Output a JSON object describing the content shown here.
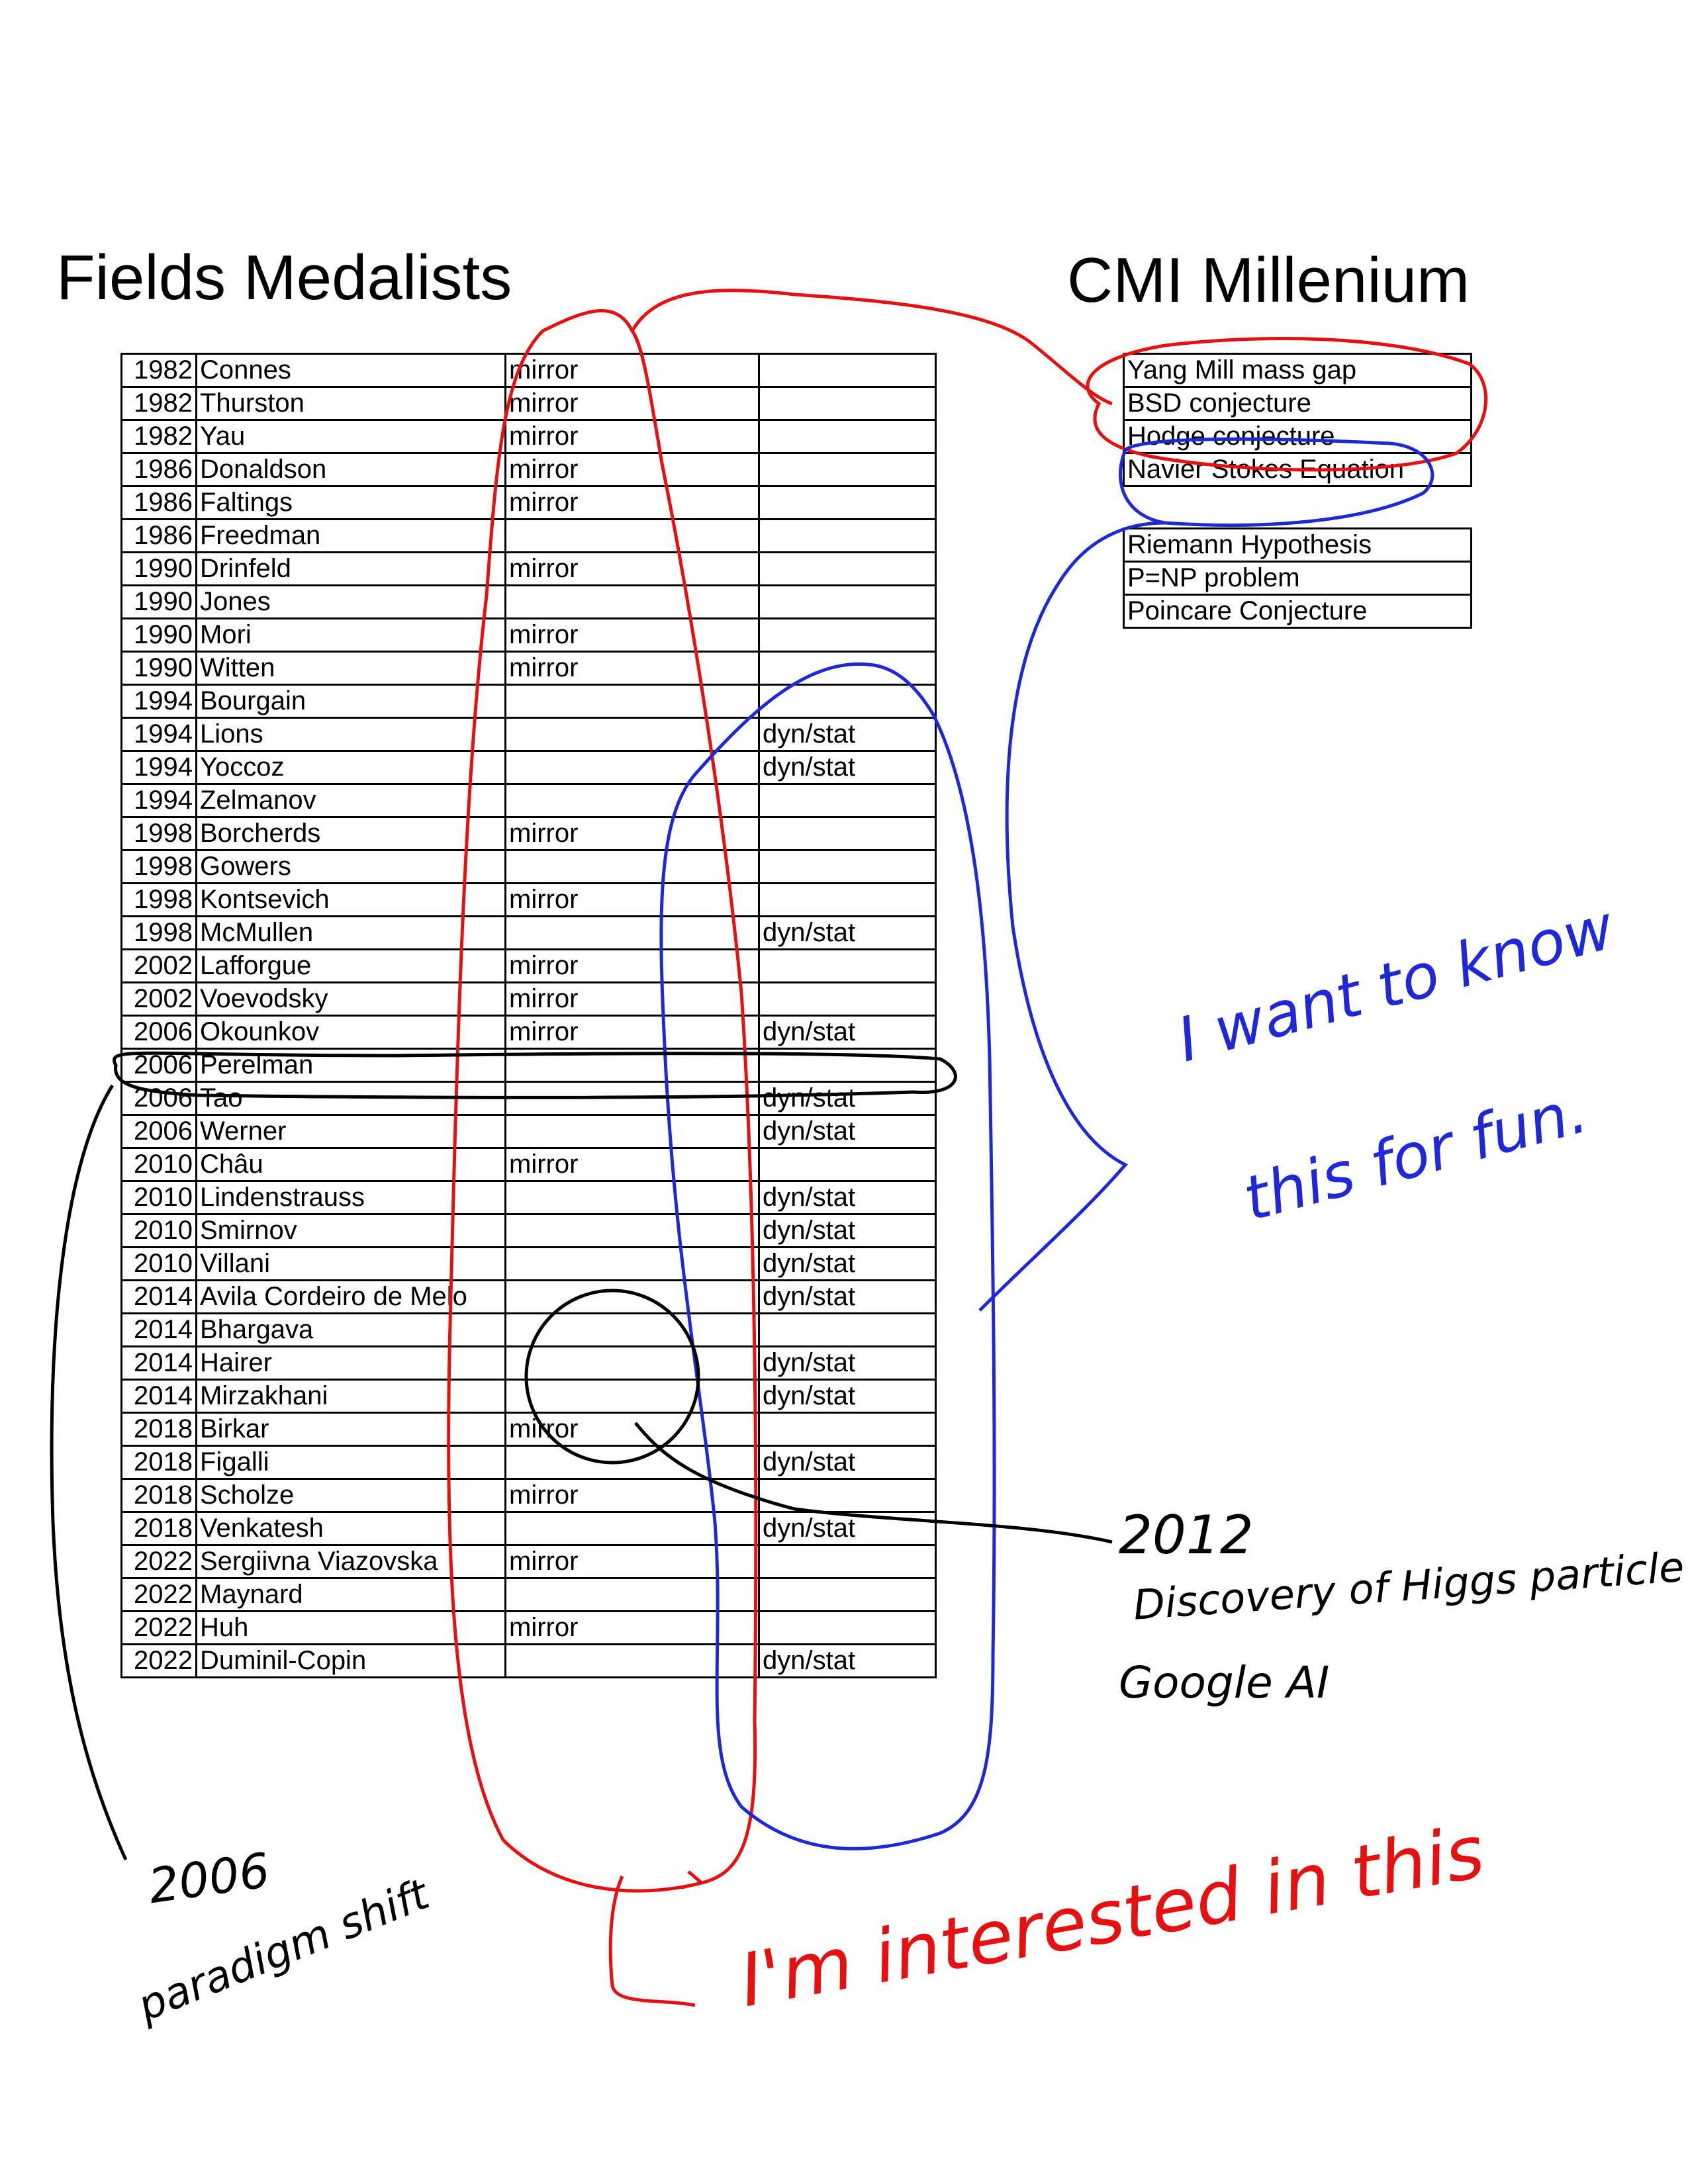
{
  "fields": {
    "title": "Fields Medalists",
    "rows": [
      {
        "year": "1982",
        "name": "Connes",
        "mirror": "mirror",
        "dyn": ""
      },
      {
        "year": "1982",
        "name": "Thurston",
        "mirror": "mirror",
        "dyn": ""
      },
      {
        "year": "1982",
        "name": "Yau",
        "mirror": "mirror",
        "dyn": ""
      },
      {
        "year": "1986",
        "name": "Donaldson",
        "mirror": "mirror",
        "dyn": ""
      },
      {
        "year": "1986",
        "name": "Faltings",
        "mirror": "mirror",
        "dyn": ""
      },
      {
        "year": "1986",
        "name": "Freedman",
        "mirror": "",
        "dyn": ""
      },
      {
        "year": "1990",
        "name": "Drinfeld",
        "mirror": "mirror",
        "dyn": ""
      },
      {
        "year": "1990",
        "name": "Jones",
        "mirror": "",
        "dyn": ""
      },
      {
        "year": "1990",
        "name": "Mori",
        "mirror": "mirror",
        "dyn": ""
      },
      {
        "year": "1990",
        "name": "Witten",
        "mirror": "mirror",
        "dyn": ""
      },
      {
        "year": "1994",
        "name": "Bourgain",
        "mirror": "",
        "dyn": ""
      },
      {
        "year": "1994",
        "name": "Lions",
        "mirror": "",
        "dyn": "dyn/stat"
      },
      {
        "year": "1994",
        "name": "Yoccoz",
        "mirror": "",
        "dyn": "dyn/stat"
      },
      {
        "year": "1994",
        "name": "Zelmanov",
        "mirror": "",
        "dyn": ""
      },
      {
        "year": "1998",
        "name": "Borcherds",
        "mirror": "mirror",
        "dyn": ""
      },
      {
        "year": "1998",
        "name": "Gowers",
        "mirror": "",
        "dyn": ""
      },
      {
        "year": "1998",
        "name": "Kontsevich",
        "mirror": "mirror",
        "dyn": ""
      },
      {
        "year": "1998",
        "name": "McMullen",
        "mirror": "",
        "dyn": "dyn/stat"
      },
      {
        "year": "2002",
        "name": "Lafforgue",
        "mirror": "mirror",
        "dyn": ""
      },
      {
        "year": "2002",
        "name": "Voevodsky",
        "mirror": "mirror",
        "dyn": ""
      },
      {
        "year": "2006",
        "name": "Okounkov",
        "mirror": "mirror",
        "dyn": "dyn/stat"
      },
      {
        "year": "2006",
        "name": "Perelman",
        "mirror": "",
        "dyn": ""
      },
      {
        "year": "2006",
        "name": "Tao",
        "mirror": "",
        "dyn": "dyn/stat"
      },
      {
        "year": "2006",
        "name": "Werner",
        "mirror": "",
        "dyn": "dyn/stat"
      },
      {
        "year": "2010",
        "name": "Châu",
        "mirror": "mirror",
        "dyn": ""
      },
      {
        "year": "2010",
        "name": "Lindenstrauss",
        "mirror": "",
        "dyn": "dyn/stat"
      },
      {
        "year": "2010",
        "name": "Smirnov",
        "mirror": "",
        "dyn": "dyn/stat"
      },
      {
        "year": "2010",
        "name": "Villani",
        "mirror": "",
        "dyn": "dyn/stat"
      },
      {
        "year": "2014",
        "name": "Avila Cordeiro de Melo",
        "mirror": "",
        "dyn": "dyn/stat"
      },
      {
        "year": "2014",
        "name": "Bhargava",
        "mirror": "",
        "dyn": ""
      },
      {
        "year": "2014",
        "name": "Hairer",
        "mirror": "",
        "dyn": "dyn/stat"
      },
      {
        "year": "2014",
        "name": "Mirzakhani",
        "mirror": "",
        "dyn": "dyn/stat"
      },
      {
        "year": "2018",
        "name": "Birkar",
        "mirror": "mirror",
        "dyn": ""
      },
      {
        "year": "2018",
        "name": "Figalli",
        "mirror": "",
        "dyn": "dyn/stat"
      },
      {
        "year": "2018",
        "name": "Scholze",
        "mirror": "mirror",
        "dyn": ""
      },
      {
        "year": "2018",
        "name": "Venkatesh",
        "mirror": "",
        "dyn": "dyn/stat"
      },
      {
        "year": "2022",
        "name": "Sergiivna Viazovska",
        "mirror": "mirror",
        "dyn": ""
      },
      {
        "year": "2022",
        "name": "Maynard",
        "mirror": "",
        "dyn": ""
      },
      {
        "year": "2022",
        "name": "Huh",
        "mirror": "mirror",
        "dyn": ""
      },
      {
        "year": "2022",
        "name": "Duminil-Copin",
        "mirror": "",
        "dyn": "dyn/stat"
      }
    ]
  },
  "cmi": {
    "title": "CMI Millenium",
    "unsolved": [
      "Yang Mill mass gap",
      "BSD conjecture",
      "Hodge conjecture",
      "Navier Stokes Equation"
    ],
    "others": [
      "Riemann Hypothesis",
      "P=NP problem",
      "Poincare Conjecture"
    ]
  },
  "annotations": {
    "fun_line1": "I want to know",
    "fun_line2": "this for fun.",
    "year_2012": "2012",
    "higgs": "Discovery of Higgs particle",
    "google": "Google AI",
    "year_2006": "2006",
    "paradigm": "paradigm shift",
    "interested": "I'm interested in this",
    "colors": {
      "red": "#e61010",
      "blue": "#1f28d6",
      "black": "#000000"
    }
  }
}
